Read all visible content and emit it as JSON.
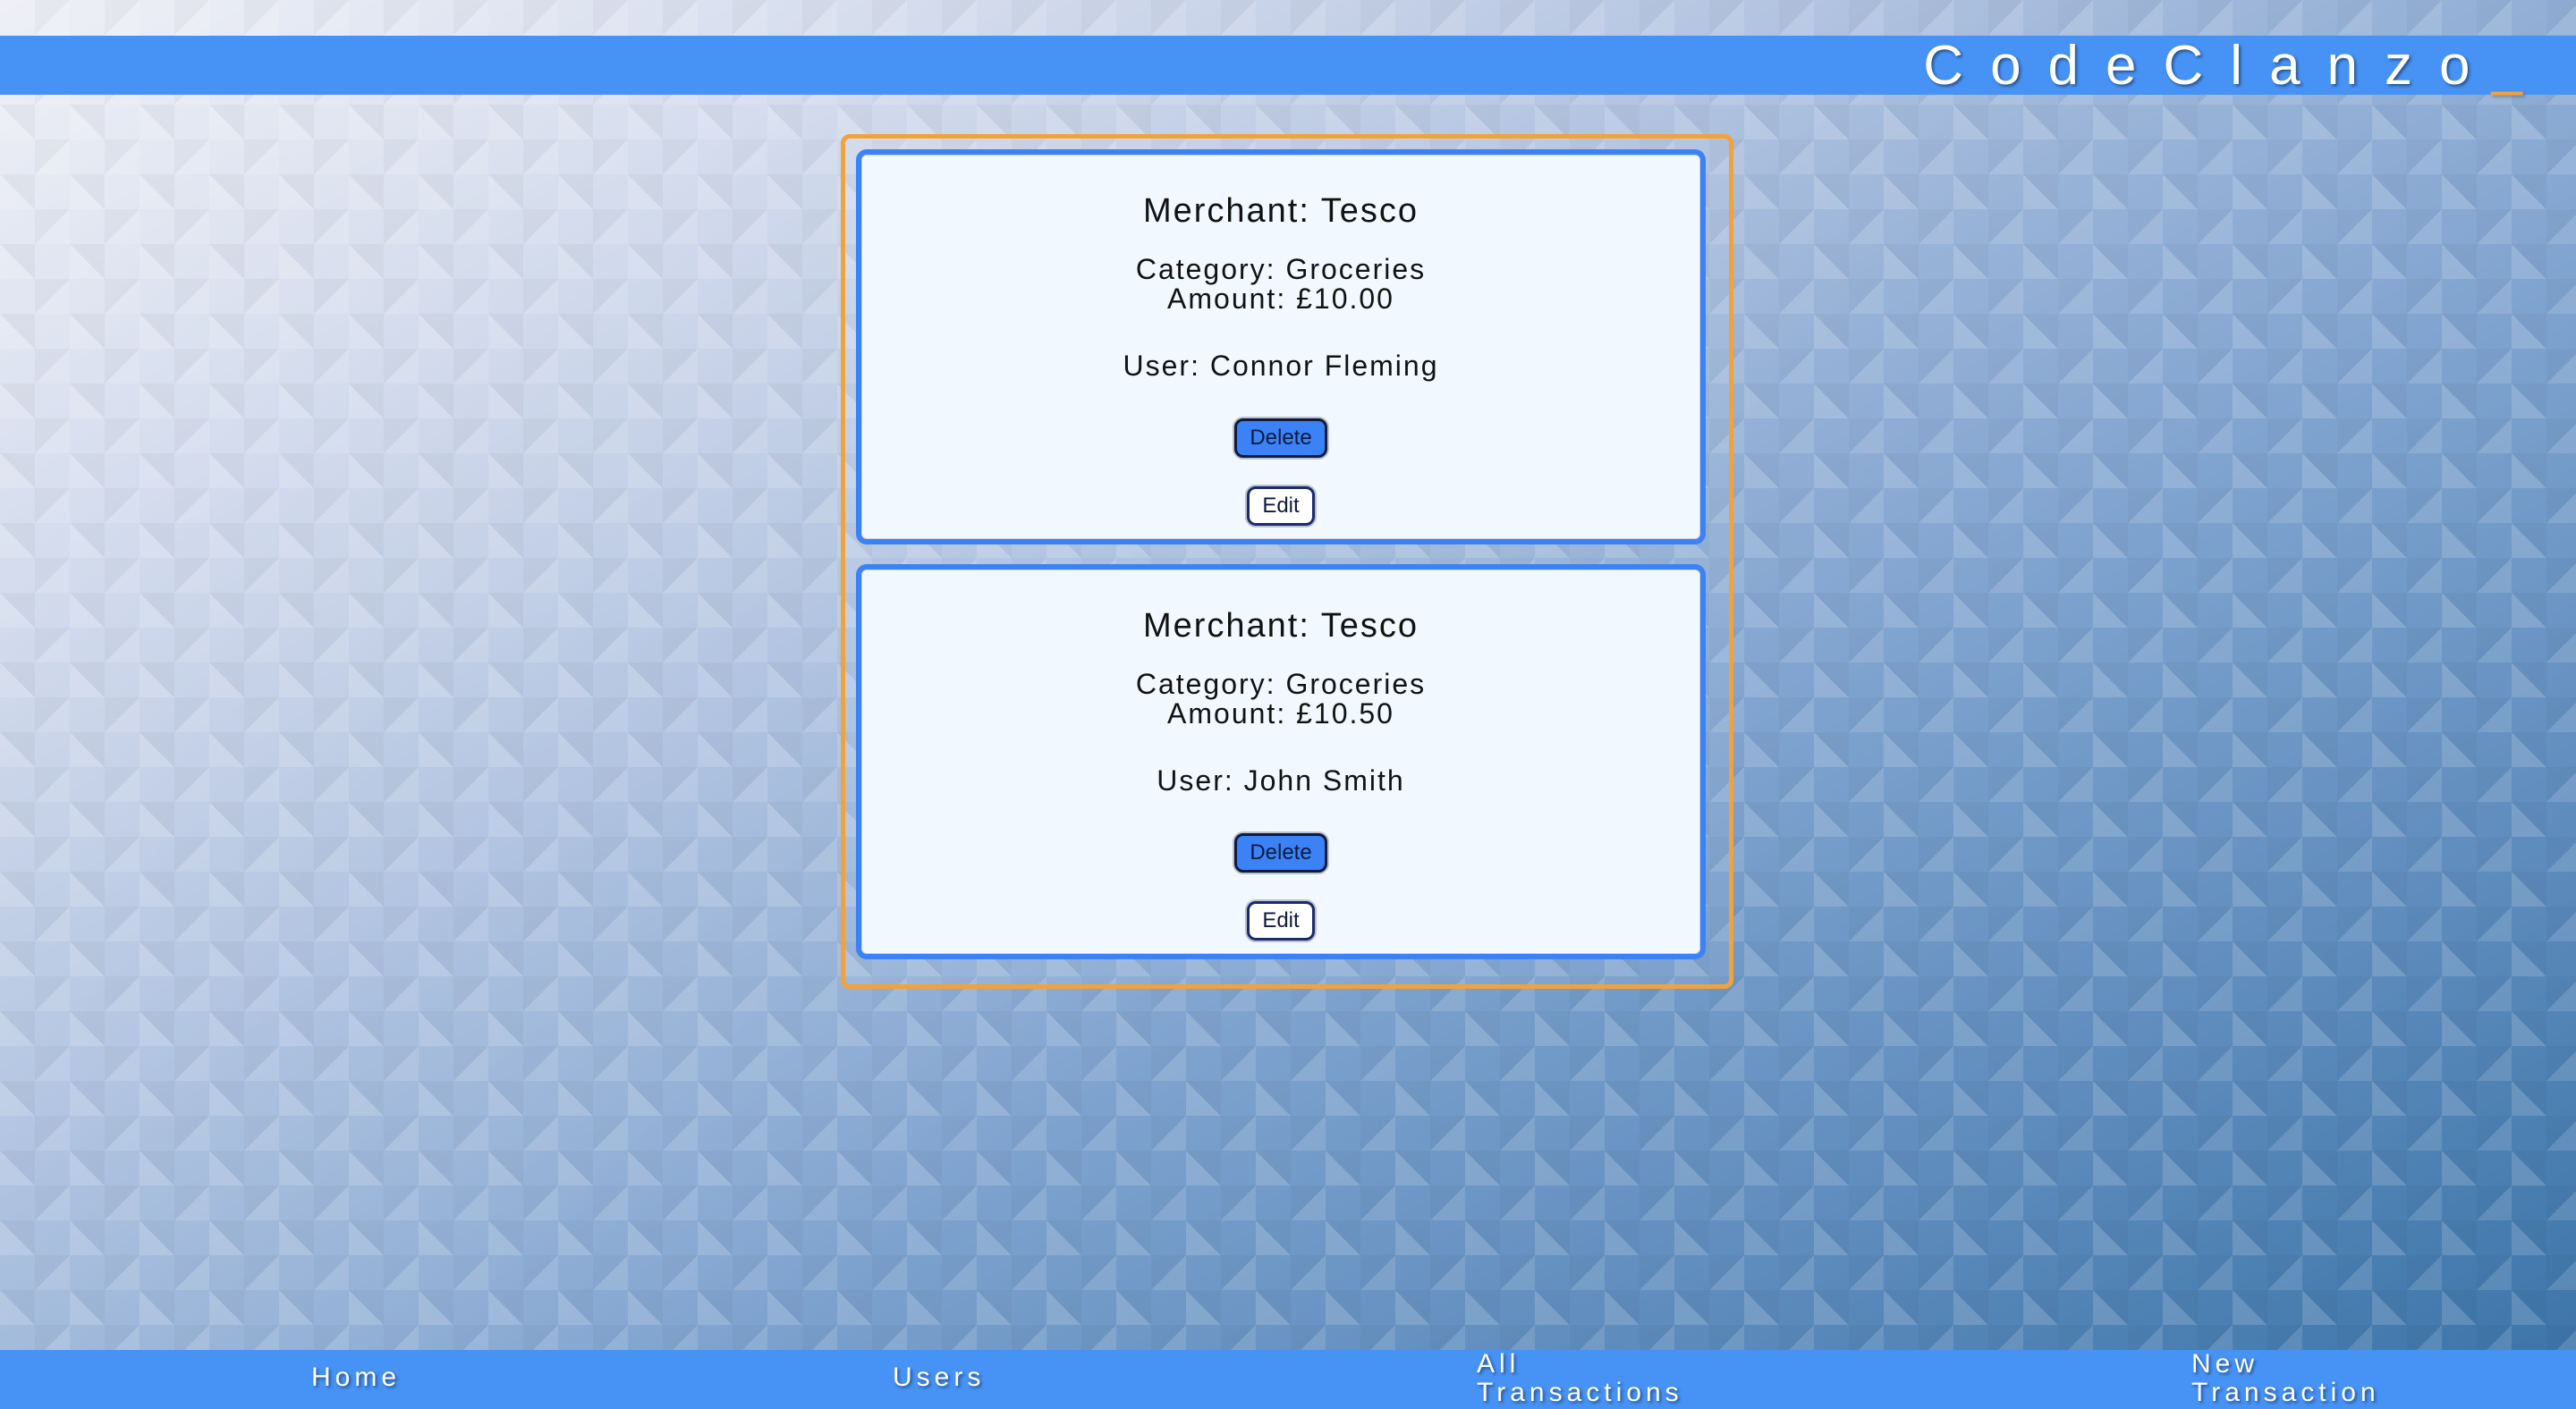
{
  "header": {
    "brand_text": "CodeClanzo",
    "brand_cursor": "_"
  },
  "transactions": [
    {
      "merchant_line": "Merchant: Tesco",
      "category_line": "Category: Groceries",
      "amount_line": "Amount: £10.00",
      "user_line": "User: Connor Fleming",
      "delete_label": "Delete",
      "edit_label": "Edit"
    },
    {
      "merchant_line": "Merchant: Tesco",
      "category_line": "Category: Groceries",
      "amount_line": "Amount: £10.50",
      "user_line": "User: John Smith",
      "delete_label": "Delete",
      "edit_label": "Edit"
    }
  ],
  "nav": {
    "home": "Home",
    "users": "Users",
    "all_transactions_line1": "All",
    "all_transactions_line2": "Transactions",
    "new_transaction_line1": "New",
    "new_transaction_line2": "Transaction"
  },
  "theme": {
    "bar_blue": "#4692F5",
    "accent_orange": "#F2A23A",
    "card_border_blue": "#3B82F6",
    "card_bg": "#F1F8FF"
  }
}
